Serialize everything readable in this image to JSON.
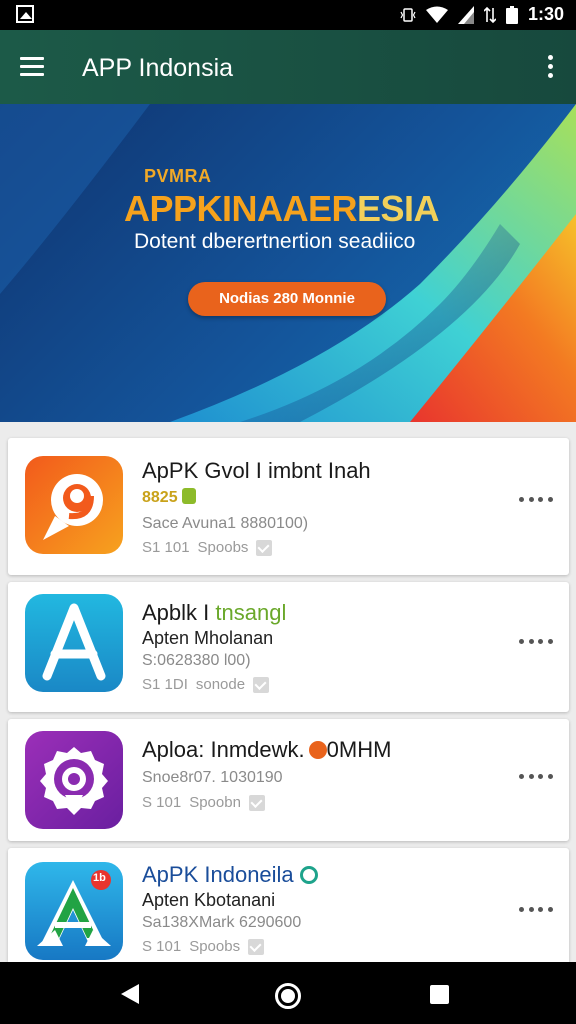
{
  "status_bar": {
    "time": "1:30",
    "icons": [
      "picture-icon",
      "vibrate-icon",
      "wifi-icon",
      "signal-icon",
      "data-icon",
      "battery-icon"
    ]
  },
  "app_bar": {
    "title": "APP Indonsia"
  },
  "banner": {
    "kicker": "PVMRA",
    "title_part1": "APPKINAAER",
    "title_part2": "ESIA",
    "subtitle": "Dotent dberertnertion seadiico",
    "cta_label": "Nodias 280 Monnie"
  },
  "apps": [
    {
      "name": "ApPK Gvol I imbnt Inah",
      "line2": "8825",
      "meta": "Sace Avuna1 8880100)",
      "size": "S1 101",
      "size_label": "Spoobs",
      "icon": "orange-g-icon"
    },
    {
      "name": "Apblk I",
      "name_highlight": "tnsangl",
      "line2": "Apten Mholanan",
      "meta": "S:0628380 l00)",
      "size": "S1 1DI",
      "size_label": "sonode",
      "icon": "blue-a-icon"
    },
    {
      "name": "Aploa: Inmdewk.",
      "name_suffix": "0MHM",
      "meta": "Snoe8r07. 1030190",
      "size": "S 101",
      "size_label": "Spoobn",
      "icon": "purple-pin-icon"
    },
    {
      "name": "ApPK Indoneila",
      "line2": "Apten Kbotanani",
      "meta": "Sa138XMark 6290600",
      "size": "S 101",
      "size_label": "Spoobs",
      "badge": "1b",
      "icon": "green-a-icon"
    }
  ],
  "colors": {
    "app_bar": "#1c5a48",
    "accent_orange": "#e9631c",
    "banner_blue": "#14549a",
    "title_gold": "#f6a21c"
  }
}
